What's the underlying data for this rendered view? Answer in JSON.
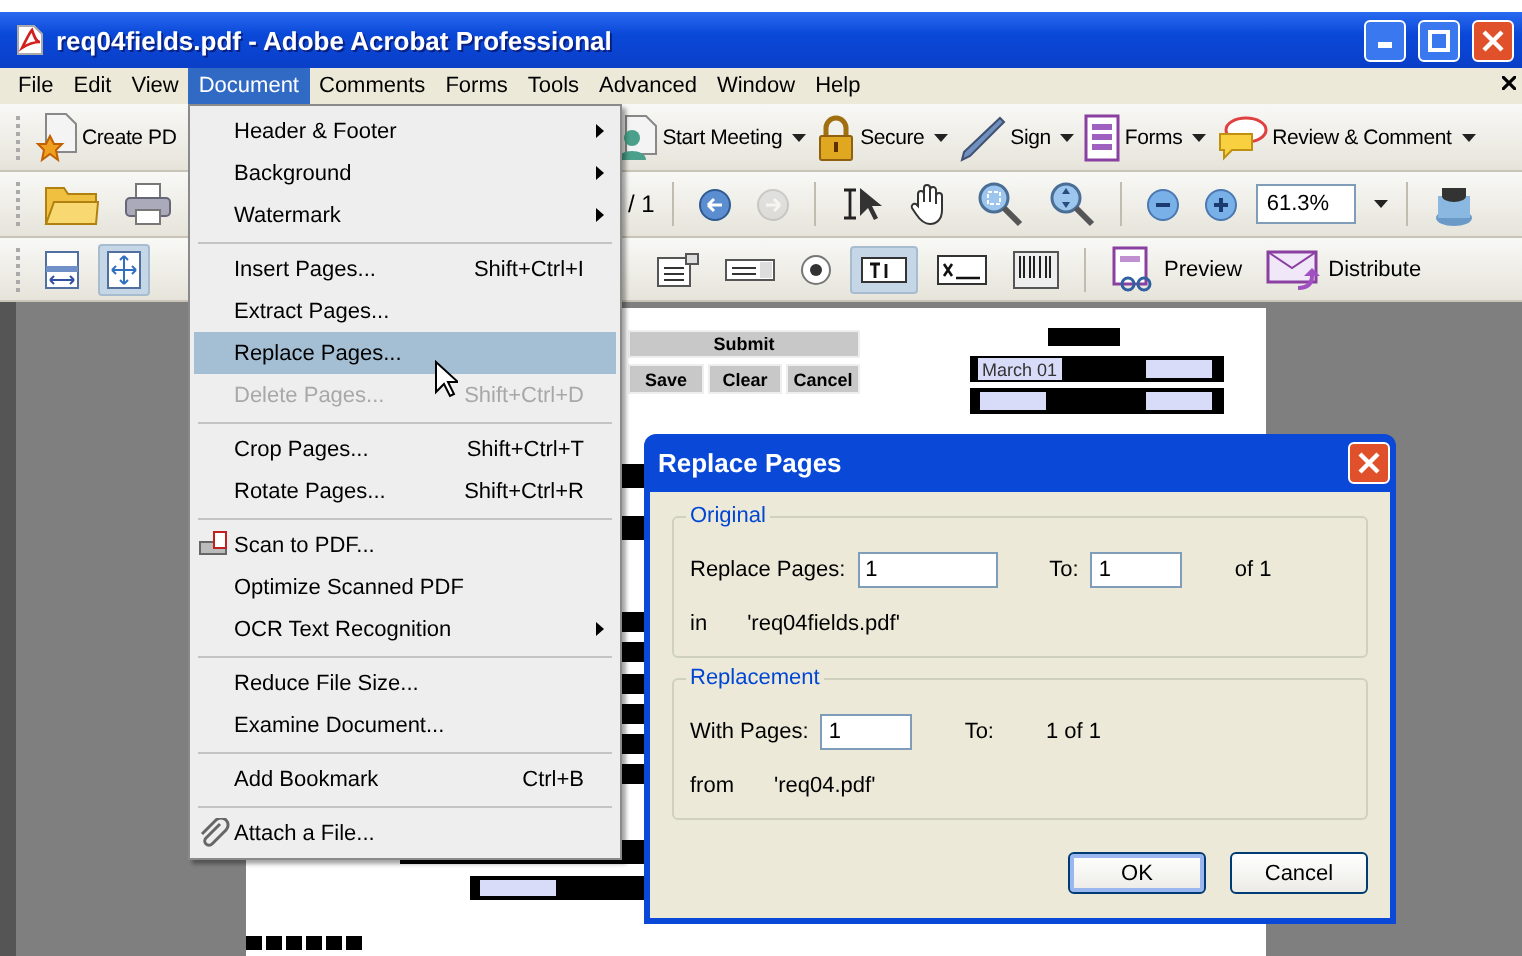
{
  "window": {
    "title": "req04fields.pdf - Adobe Acrobat Professional"
  },
  "menubar": [
    {
      "label": "File",
      "selected": false
    },
    {
      "label": "Edit",
      "selected": false
    },
    {
      "label": "View",
      "selected": false
    },
    {
      "label": "Document",
      "selected": true
    },
    {
      "label": "Comments",
      "selected": false
    },
    {
      "label": "Forms",
      "selected": false
    },
    {
      "label": "Tools",
      "selected": false
    },
    {
      "label": "Advanced",
      "selected": false
    },
    {
      "label": "Window",
      "selected": false
    },
    {
      "label": "Help",
      "selected": false
    }
  ],
  "task_buttons": [
    {
      "kind": "create",
      "label": "Create PD",
      "dropdown": false
    },
    {
      "kind": "meeting",
      "label": "Start Meeting",
      "dropdown": true
    },
    {
      "kind": "secure",
      "label": "Secure",
      "dropdown": true
    },
    {
      "kind": "sign",
      "label": "Sign",
      "dropdown": true
    },
    {
      "kind": "forms",
      "label": "Forms",
      "dropdown": true
    },
    {
      "kind": "review",
      "label": "Review & Comment",
      "dropdown": true
    }
  ],
  "navigation": {
    "page_count": "/ 1",
    "zoom": "61.3%"
  },
  "form_tools": [
    {
      "kind": "fitwidth",
      "selected": false
    },
    {
      "kind": "fitpage",
      "selected": true
    },
    {
      "kind": "listbox",
      "selected": false
    },
    {
      "kind": "combobox",
      "selected": false
    },
    {
      "kind": "radio",
      "selected": false
    },
    {
      "kind": "textfield",
      "selected": true
    },
    {
      "kind": "signature",
      "selected": false
    },
    {
      "kind": "barcode",
      "selected": false
    }
  ],
  "form_actions": [
    {
      "kind": "preview",
      "label": "Preview"
    },
    {
      "kind": "distribute",
      "label": "Distribute"
    }
  ],
  "document_page": {
    "buttons": [
      "Submit",
      "Save",
      "Clear",
      "Cancel"
    ],
    "date_value": "March 01"
  },
  "menu": [
    {
      "kind": "item",
      "label": "Header & Footer",
      "submenu": true,
      "disabled": false,
      "selected": false
    },
    {
      "kind": "item",
      "label": "Background",
      "submenu": true,
      "disabled": false,
      "selected": false
    },
    {
      "kind": "item",
      "label": "Watermark",
      "submenu": true,
      "disabled": false,
      "selected": false
    },
    {
      "kind": "separator"
    },
    {
      "kind": "item",
      "label": "Insert Pages...",
      "shortcut": "Shift+Ctrl+I",
      "submenu": false,
      "disabled": false,
      "selected": false
    },
    {
      "kind": "item",
      "label": "Extract Pages...",
      "submenu": false,
      "disabled": false,
      "selected": false
    },
    {
      "kind": "item",
      "label": "Replace Pages...",
      "submenu": false,
      "disabled": false,
      "selected": true
    },
    {
      "kind": "item",
      "label": "Delete Pages...",
      "shortcut": "Shift+Ctrl+D",
      "submenu": false,
      "disabled": true,
      "selected": false
    },
    {
      "kind": "separator"
    },
    {
      "kind": "item",
      "label": "Crop Pages...",
      "shortcut": "Shift+Ctrl+T",
      "submenu": false,
      "disabled": false,
      "selected": false
    },
    {
      "kind": "item",
      "label": "Rotate Pages...",
      "shortcut": "Shift+Ctrl+R",
      "submenu": false,
      "disabled": false,
      "selected": false
    },
    {
      "kind": "separator"
    },
    {
      "kind": "scan",
      "label": "Scan to PDF...",
      "submenu": false,
      "disabled": false,
      "selected": false
    },
    {
      "kind": "item",
      "label": "Optimize Scanned PDF",
      "submenu": false,
      "disabled": false,
      "selected": false
    },
    {
      "kind": "item",
      "label": "OCR Text Recognition",
      "submenu": true,
      "disabled": false,
      "selected": false
    },
    {
      "kind": "separator"
    },
    {
      "kind": "item",
      "label": "Reduce File Size...",
      "submenu": false,
      "disabled": false,
      "selected": false
    },
    {
      "kind": "item",
      "label": "Examine Document...",
      "submenu": false,
      "disabled": false,
      "selected": false
    },
    {
      "kind": "separator"
    },
    {
      "kind": "item",
      "label": "Add Bookmark",
      "shortcut": "Ctrl+B",
      "submenu": false,
      "disabled": false,
      "selected": false
    },
    {
      "kind": "separator"
    },
    {
      "kind": "attach",
      "label": "Attach a File...",
      "submenu": false,
      "disabled": false,
      "selected": false
    }
  ],
  "dialog": {
    "title": "Replace Pages",
    "original": {
      "legend": "Original",
      "from_label": "Replace Pages:",
      "from_value": "1",
      "to_label": "To:",
      "to_value": "1",
      "of_label": "of 1",
      "in_label": "in",
      "file": "'req04fields.pdf'"
    },
    "replacement": {
      "legend": "Replacement",
      "from_label": "With Pages:",
      "from_value": "1",
      "to_label": "To:",
      "range": "1 of 1",
      "in_label": "from",
      "file": "'req04.pdf'"
    },
    "buttons": [
      {
        "label": "OK",
        "default": true
      },
      {
        "label": "Cancel",
        "default": false
      }
    ]
  }
}
